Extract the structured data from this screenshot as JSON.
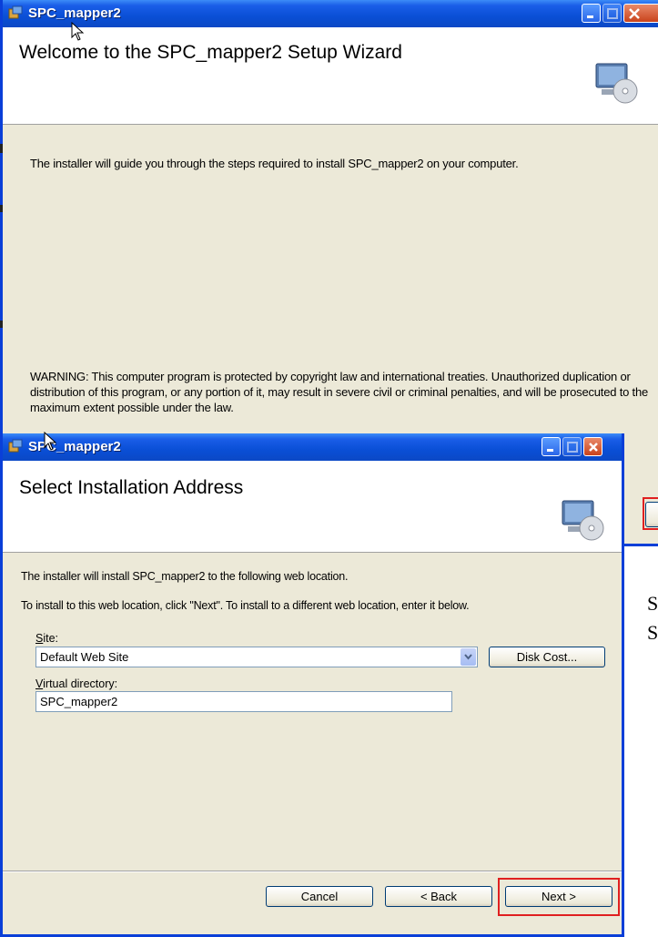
{
  "back_window": {
    "title": "SPC_mapper2",
    "heading": "Welcome to the SPC_mapper2 Setup Wizard",
    "intro": "The installer will guide you through the steps required to install SPC_mapper2 on your computer.",
    "warning": "WARNING: This computer program is protected by copyright law and international treaties. Unauthorized duplication or distribution of this program, or any portion of it, may result in severe civil or criminal penalties, and will be prosecuted to the maximum extent possible under the law."
  },
  "front_window": {
    "title": "SPC_mapper2",
    "heading": "Select Installation Address",
    "line1": "The installer will install SPC_mapper2 to the following web location.",
    "line2": "To install to this web location, click \"Next\". To install to a different web location, enter it below.",
    "site_label_u": "S",
    "site_label_rest": "ite:",
    "site_value": "Default Web Site",
    "disk_cost_label": "Disk Cost...",
    "vdir_label_u": "V",
    "vdir_label_rest": "irtual directory:",
    "vdir_value": "SPC_mapper2",
    "cancel_label": "Cancel",
    "back_label": "< Back",
    "next_label": "Next >"
  },
  "side_text": {
    "line1": "S",
    "line2": "S"
  },
  "colors": {
    "titlebar": "#0a4fd6",
    "dialog_bg": "#ece9d8",
    "highlight": "#e02020"
  }
}
